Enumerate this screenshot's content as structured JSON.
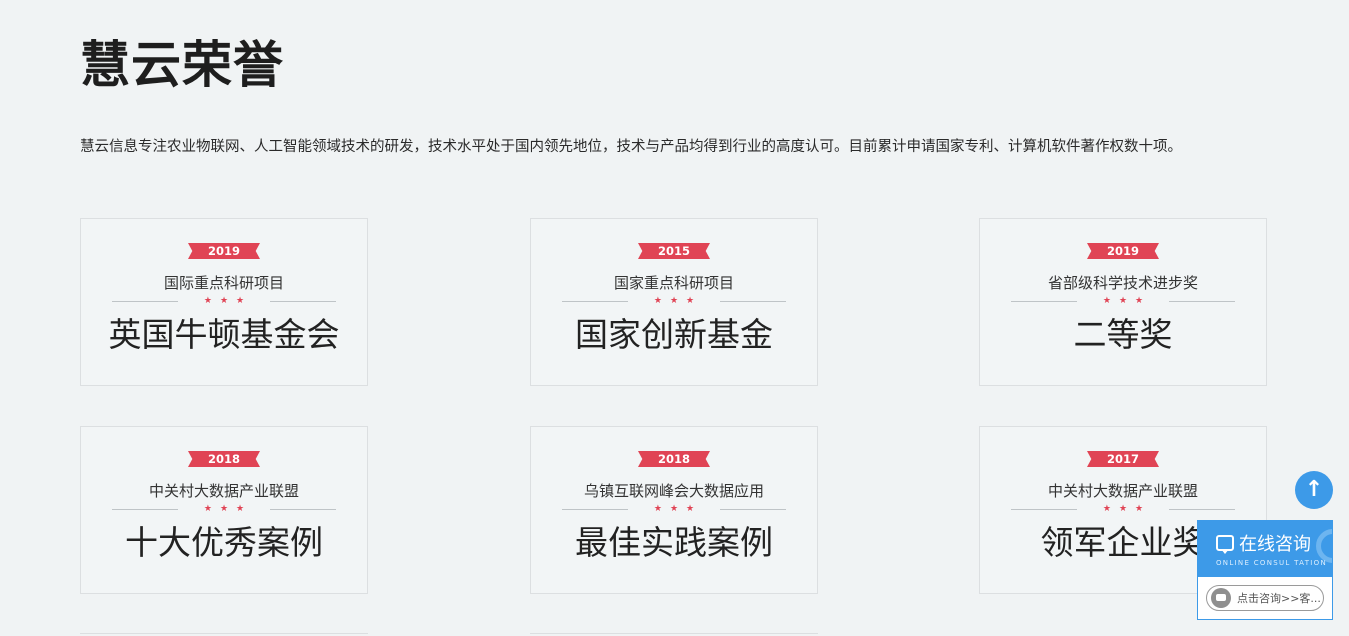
{
  "page": {
    "title": "慧云荣誉",
    "intro": "慧云信息专注农业物联网、人工智能领域技术的研发，技术水平处于国内领先地位，技术与产品均得到行业的高度认可。目前累计申请国家专利、计算机软件著作权数十项。"
  },
  "awards": [
    {
      "year": "2019",
      "org": "国际重点科研项目",
      "stars": "★★★",
      "name": "英国牛顿基金会"
    },
    {
      "year": "2015",
      "org": "国家重点科研项目",
      "stars": "★★★",
      "name": "国家创新基金"
    },
    {
      "year": "2019",
      "org": "省部级科学技术进步奖",
      "stars": "★★★",
      "name": "二等奖"
    },
    {
      "year": "2018",
      "org": "中关村大数据产业联盟",
      "stars": "★★★",
      "name": "十大优秀案例"
    },
    {
      "year": "2018",
      "org": "乌镇互联网峰会大数据应用",
      "stars": "★★★",
      "name": "最佳实践案例"
    },
    {
      "year": "2017",
      "org": "中关村大数据产业联盟",
      "stars": "★★★",
      "name": "领军企业奖"
    }
  ],
  "widgets": {
    "to_top_icon": "arrow-up-icon",
    "to_top_glyph": "↑",
    "consult_title": "在线咨询",
    "consult_subtitle": "ONLINE CONSUL TATION",
    "consult_button": "点击咨询>>客..."
  },
  "colors": {
    "accent_red": "#e04455",
    "accent_blue": "#3d9ae8",
    "background": "#f0f3f4"
  }
}
